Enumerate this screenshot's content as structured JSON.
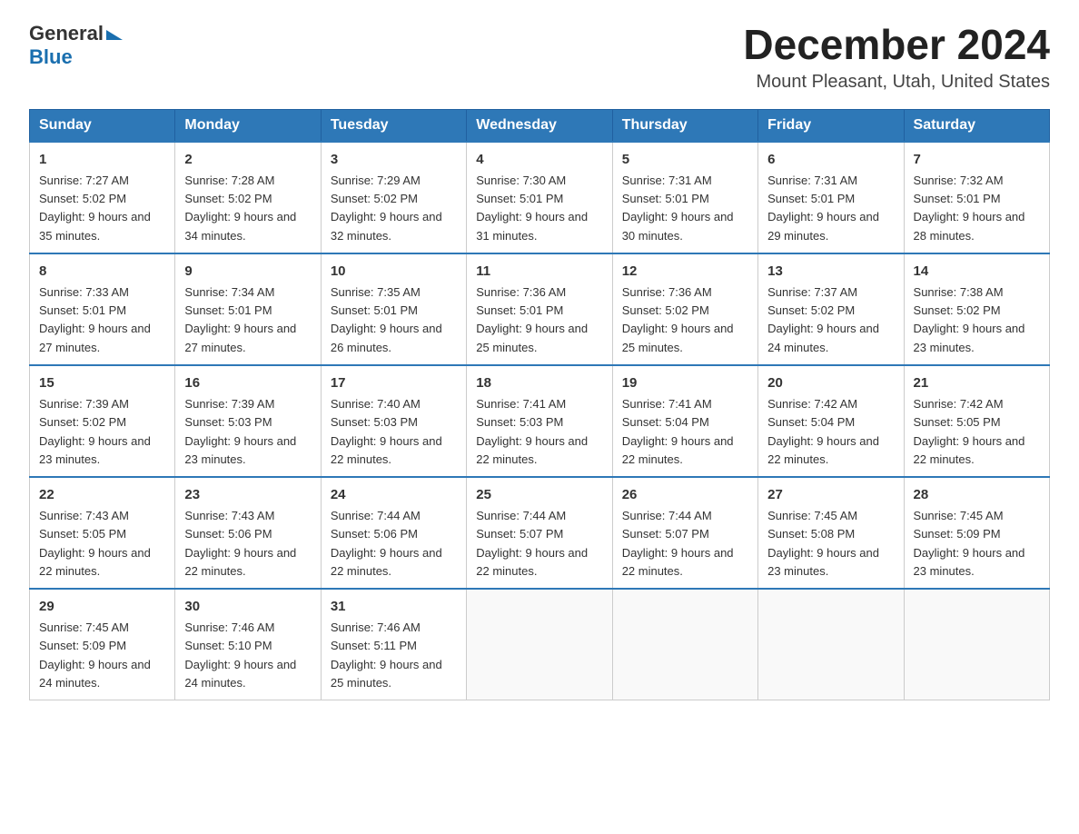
{
  "header": {
    "logo_general": "General",
    "logo_blue": "Blue",
    "month_title": "December 2024",
    "location": "Mount Pleasant, Utah, United States"
  },
  "weekdays": [
    "Sunday",
    "Monday",
    "Tuesday",
    "Wednesday",
    "Thursday",
    "Friday",
    "Saturday"
  ],
  "weeks": [
    [
      {
        "day": "1",
        "sunrise": "7:27 AM",
        "sunset": "5:02 PM",
        "daylight": "9 hours and 35 minutes."
      },
      {
        "day": "2",
        "sunrise": "7:28 AM",
        "sunset": "5:02 PM",
        "daylight": "9 hours and 34 minutes."
      },
      {
        "day": "3",
        "sunrise": "7:29 AM",
        "sunset": "5:02 PM",
        "daylight": "9 hours and 32 minutes."
      },
      {
        "day": "4",
        "sunrise": "7:30 AM",
        "sunset": "5:01 PM",
        "daylight": "9 hours and 31 minutes."
      },
      {
        "day": "5",
        "sunrise": "7:31 AM",
        "sunset": "5:01 PM",
        "daylight": "9 hours and 30 minutes."
      },
      {
        "day": "6",
        "sunrise": "7:31 AM",
        "sunset": "5:01 PM",
        "daylight": "9 hours and 29 minutes."
      },
      {
        "day": "7",
        "sunrise": "7:32 AM",
        "sunset": "5:01 PM",
        "daylight": "9 hours and 28 minutes."
      }
    ],
    [
      {
        "day": "8",
        "sunrise": "7:33 AM",
        "sunset": "5:01 PM",
        "daylight": "9 hours and 27 minutes."
      },
      {
        "day": "9",
        "sunrise": "7:34 AM",
        "sunset": "5:01 PM",
        "daylight": "9 hours and 27 minutes."
      },
      {
        "day": "10",
        "sunrise": "7:35 AM",
        "sunset": "5:01 PM",
        "daylight": "9 hours and 26 minutes."
      },
      {
        "day": "11",
        "sunrise": "7:36 AM",
        "sunset": "5:01 PM",
        "daylight": "9 hours and 25 minutes."
      },
      {
        "day": "12",
        "sunrise": "7:36 AM",
        "sunset": "5:02 PM",
        "daylight": "9 hours and 25 minutes."
      },
      {
        "day": "13",
        "sunrise": "7:37 AM",
        "sunset": "5:02 PM",
        "daylight": "9 hours and 24 minutes."
      },
      {
        "day": "14",
        "sunrise": "7:38 AM",
        "sunset": "5:02 PM",
        "daylight": "9 hours and 23 minutes."
      }
    ],
    [
      {
        "day": "15",
        "sunrise": "7:39 AM",
        "sunset": "5:02 PM",
        "daylight": "9 hours and 23 minutes."
      },
      {
        "day": "16",
        "sunrise": "7:39 AM",
        "sunset": "5:03 PM",
        "daylight": "9 hours and 23 minutes."
      },
      {
        "day": "17",
        "sunrise": "7:40 AM",
        "sunset": "5:03 PM",
        "daylight": "9 hours and 22 minutes."
      },
      {
        "day": "18",
        "sunrise": "7:41 AM",
        "sunset": "5:03 PM",
        "daylight": "9 hours and 22 minutes."
      },
      {
        "day": "19",
        "sunrise": "7:41 AM",
        "sunset": "5:04 PM",
        "daylight": "9 hours and 22 minutes."
      },
      {
        "day": "20",
        "sunrise": "7:42 AM",
        "sunset": "5:04 PM",
        "daylight": "9 hours and 22 minutes."
      },
      {
        "day": "21",
        "sunrise": "7:42 AM",
        "sunset": "5:05 PM",
        "daylight": "9 hours and 22 minutes."
      }
    ],
    [
      {
        "day": "22",
        "sunrise": "7:43 AM",
        "sunset": "5:05 PM",
        "daylight": "9 hours and 22 minutes."
      },
      {
        "day": "23",
        "sunrise": "7:43 AM",
        "sunset": "5:06 PM",
        "daylight": "9 hours and 22 minutes."
      },
      {
        "day": "24",
        "sunrise": "7:44 AM",
        "sunset": "5:06 PM",
        "daylight": "9 hours and 22 minutes."
      },
      {
        "day": "25",
        "sunrise": "7:44 AM",
        "sunset": "5:07 PM",
        "daylight": "9 hours and 22 minutes."
      },
      {
        "day": "26",
        "sunrise": "7:44 AM",
        "sunset": "5:07 PM",
        "daylight": "9 hours and 22 minutes."
      },
      {
        "day": "27",
        "sunrise": "7:45 AM",
        "sunset": "5:08 PM",
        "daylight": "9 hours and 23 minutes."
      },
      {
        "day": "28",
        "sunrise": "7:45 AM",
        "sunset": "5:09 PM",
        "daylight": "9 hours and 23 minutes."
      }
    ],
    [
      {
        "day": "29",
        "sunrise": "7:45 AM",
        "sunset": "5:09 PM",
        "daylight": "9 hours and 24 minutes."
      },
      {
        "day": "30",
        "sunrise": "7:46 AM",
        "sunset": "5:10 PM",
        "daylight": "9 hours and 24 minutes."
      },
      {
        "day": "31",
        "sunrise": "7:46 AM",
        "sunset": "5:11 PM",
        "daylight": "9 hours and 25 minutes."
      },
      null,
      null,
      null,
      null
    ]
  ],
  "labels": {
    "sunrise_prefix": "Sunrise: ",
    "sunset_prefix": "Sunset: ",
    "daylight_prefix": "Daylight: "
  }
}
